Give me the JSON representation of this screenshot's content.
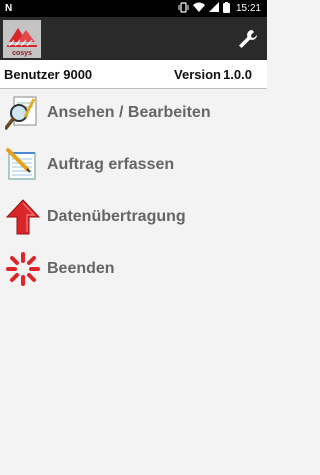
{
  "status_bar": {
    "left_icon": "N",
    "time": "15:21",
    "icons": [
      "vibrate-icon",
      "wifi-icon",
      "signal-icon",
      "battery-icon"
    ]
  },
  "toolbar": {
    "logo_icon": "cosys-logo-icon",
    "settings_icon": "wrench-icon"
  },
  "info": {
    "user": "Benutzer 9000",
    "version_label": "Version",
    "version_number": "1.0.0"
  },
  "menu": {
    "items": [
      {
        "label": "Ansehen / Bearbeiten",
        "icon": "magnifier-document-icon"
      },
      {
        "label": "Auftrag erfassen",
        "icon": "notepad-pencil-icon"
      },
      {
        "label": "Datenübertragung",
        "icon": "red-up-arrow-icon"
      },
      {
        "label": "Beenden",
        "icon": "spinner-exit-icon"
      }
    ]
  },
  "colors": {
    "background": "#f3f3f3",
    "toolbar": "#2a2a2a",
    "label": "#666666",
    "accent_red": "#d8262b"
  }
}
